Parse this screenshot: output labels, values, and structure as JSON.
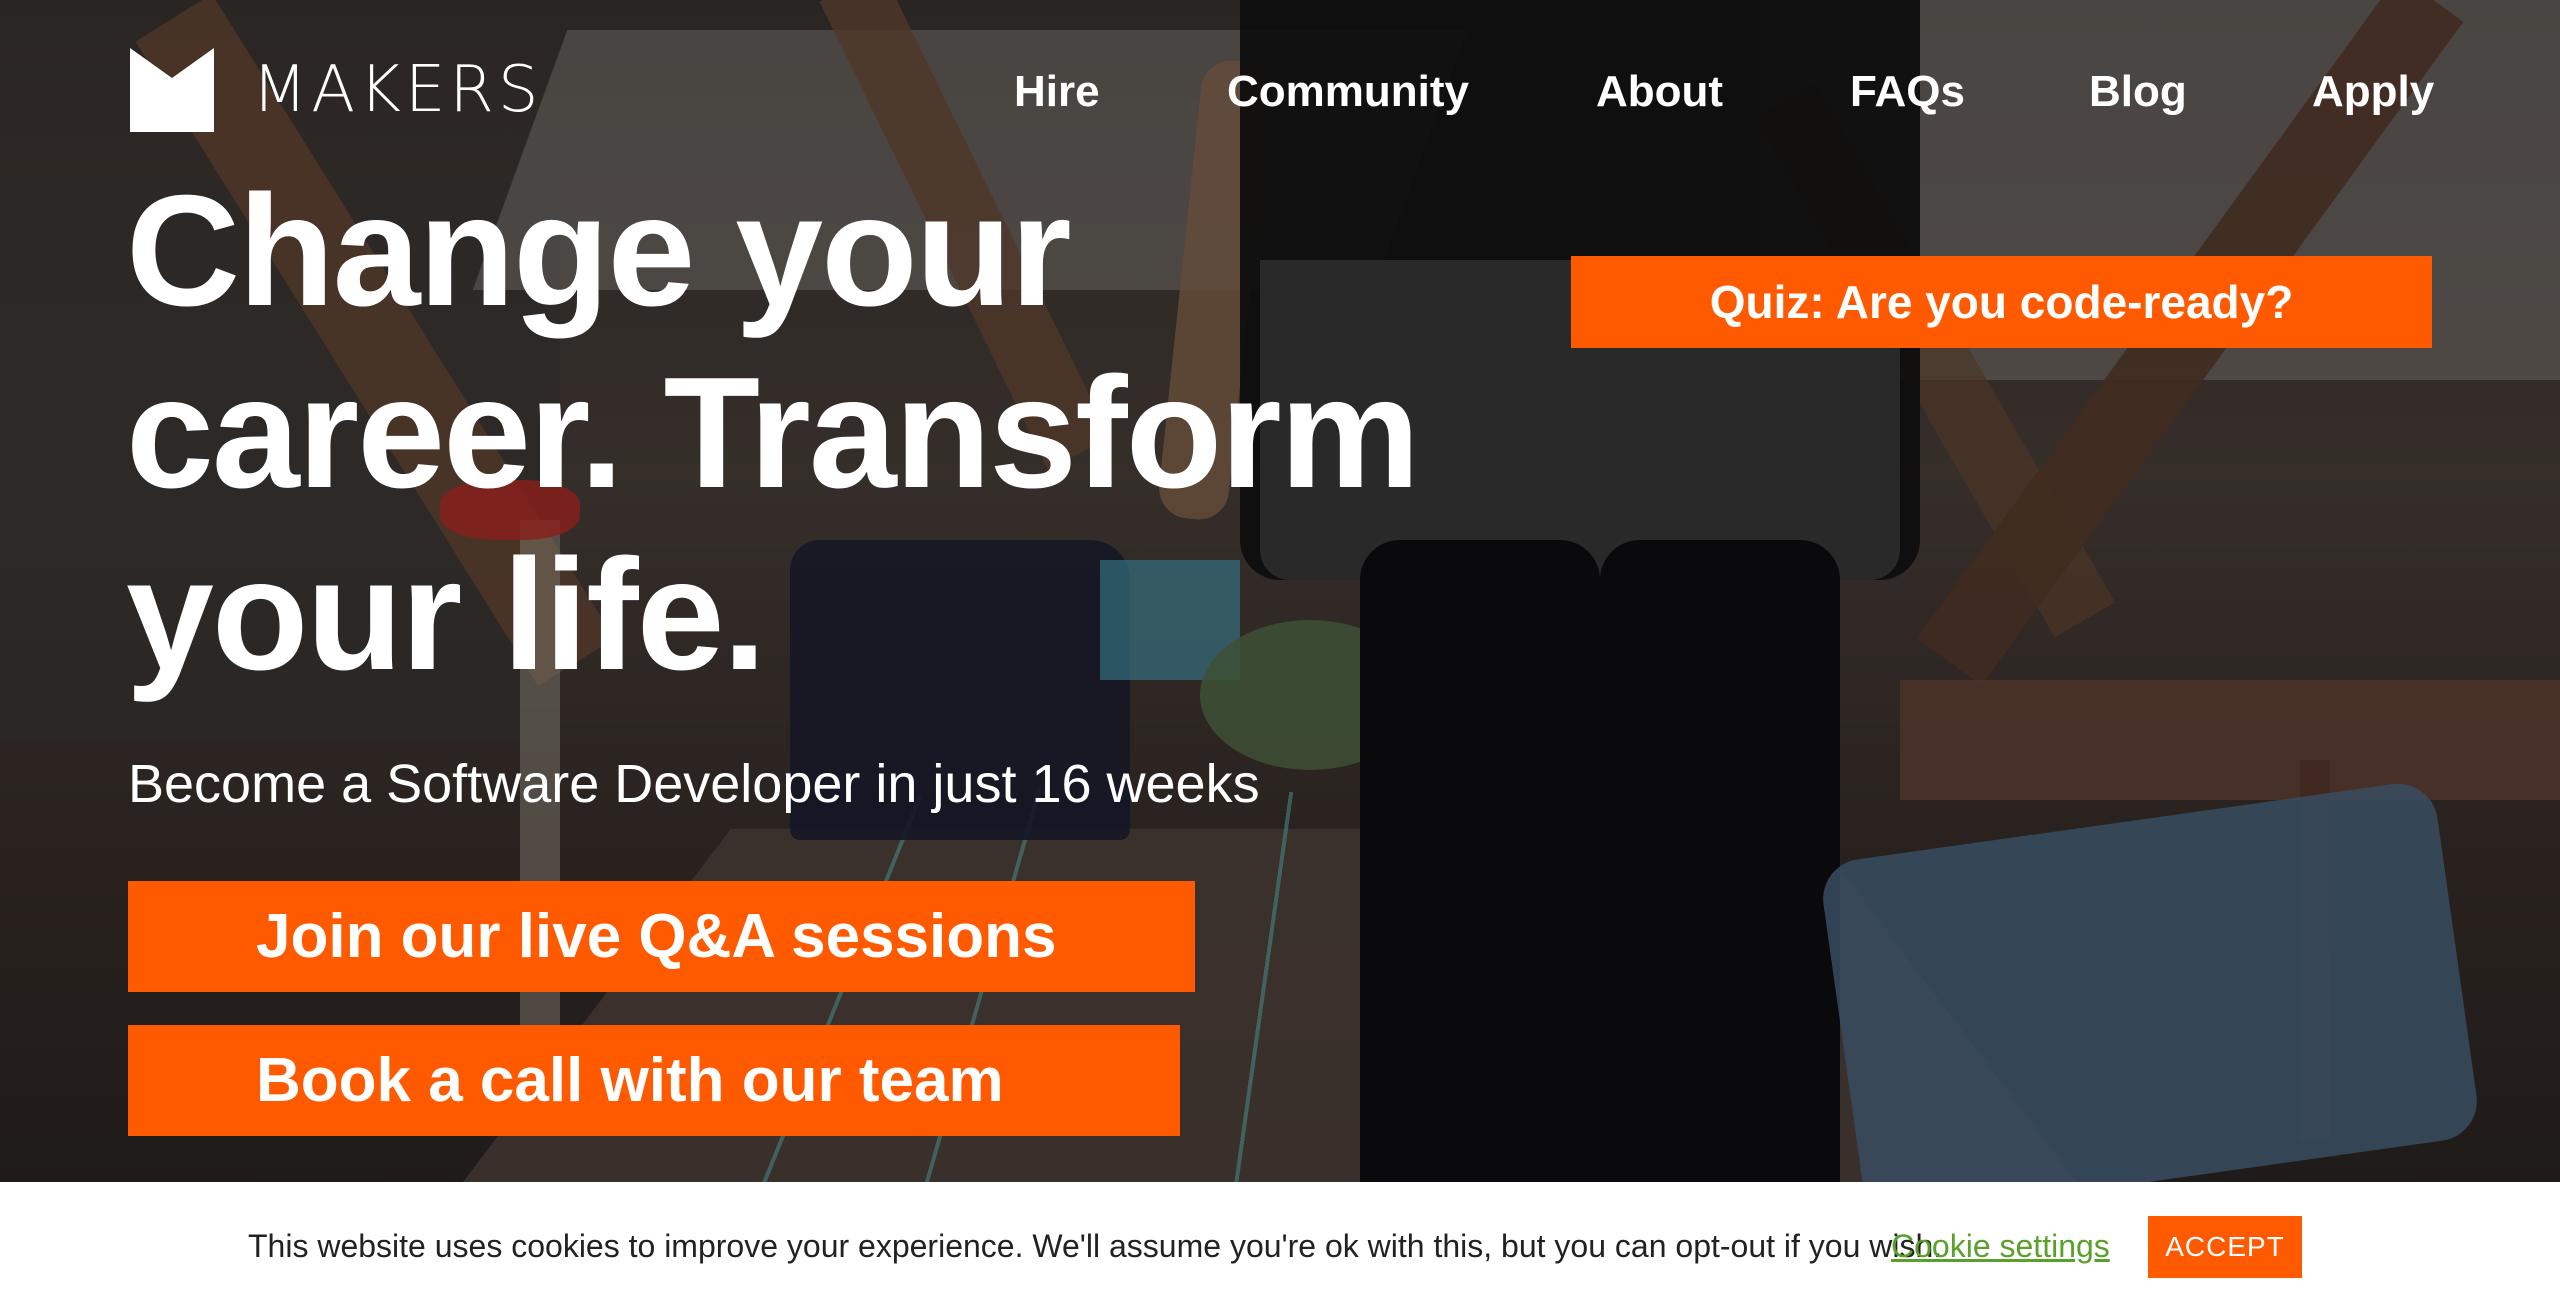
{
  "brand": {
    "name": "MAKERS",
    "logo_icon": "makers-m-logo-icon"
  },
  "nav": {
    "items": [
      {
        "label": "Hire"
      },
      {
        "label": "Community"
      },
      {
        "label": "About"
      },
      {
        "label": "FAQs"
      },
      {
        "label": "Blog"
      },
      {
        "label": "Apply"
      }
    ]
  },
  "hero": {
    "headline_line1": "Change your",
    "headline_line2": "career. Transform",
    "headline_line3": "your life.",
    "subheadline": "Become a Software Developer in just 16 weeks",
    "cta_primary": "Join our live Q&A sessions",
    "cta_secondary": "Book a call with our team",
    "quiz_button": "Quiz: Are you code-ready?"
  },
  "cookie_bar": {
    "message": "This website uses cookies to improve your experience. We'll assume you're ok with this, but you can opt-out if you wish.",
    "settings_link": "Cookie settings",
    "accept_label": "ACCEPT"
  },
  "colors": {
    "accent": "#ff5a00",
    "link_green": "#5aa02c",
    "text_white": "#ffffff"
  }
}
